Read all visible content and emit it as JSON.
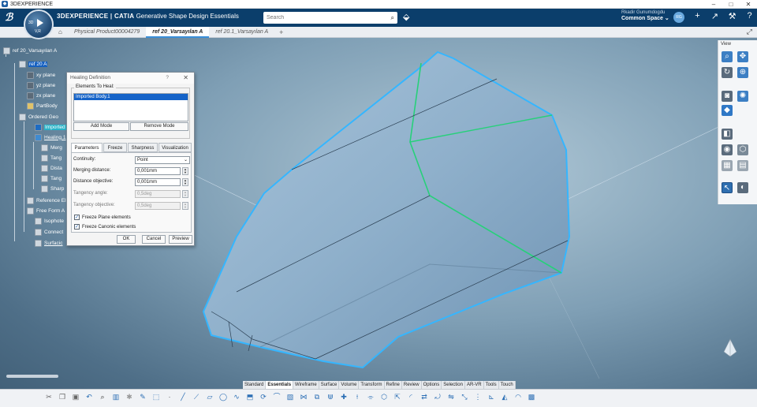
{
  "window": {
    "title": "3DEXPERIENCE",
    "controls": [
      "–",
      "□",
      "✕"
    ]
  },
  "topbar": {
    "brand_bold": "3DEXPERIENCE | CATIA",
    "brand_app": "Generative Shape Design Essentials",
    "compass_top": "3D",
    "compass_bottom": "V,R",
    "search_placeholder": "Search",
    "user_name": "Rkadir Gunumdogdu",
    "space": "Common Space ⌄",
    "avatar": "RG",
    "icons": [
      "+",
      "↗",
      "⚒",
      "?"
    ]
  },
  "tabs": {
    "items": [
      {
        "label": "Physical Product00004279",
        "active": false
      },
      {
        "label": "ref 20_Varsayılan A",
        "active": true
      },
      {
        "label": "ref 20.1_Varsayılan A",
        "active": false
      }
    ],
    "new_tab": "+"
  },
  "tree": {
    "nodes": [
      {
        "label": "ref 20_Varsayılan A",
        "style": "normal"
      },
      {
        "label": "ref 20 A",
        "style": "hl"
      },
      {
        "label": "xy plane",
        "style": "normal"
      },
      {
        "label": "yz plane",
        "style": "normal"
      },
      {
        "label": "zx plane",
        "style": "normal"
      },
      {
        "label": "PartBody",
        "style": "normal"
      },
      {
        "label": "Ordered Geo",
        "style": "normal"
      },
      {
        "label": "Imported",
        "style": "cyan"
      },
      {
        "label": "Healing.1",
        "style": "ul"
      },
      {
        "label": "Merg",
        "style": "normal"
      },
      {
        "label": "Tang",
        "style": "normal"
      },
      {
        "label": "Dista",
        "style": "normal"
      },
      {
        "label": "Tang",
        "style": "normal"
      },
      {
        "label": "Sharp",
        "style": "normal"
      },
      {
        "label": "Reference El",
        "style": "normal"
      },
      {
        "label": "Free Form A",
        "style": "normal"
      },
      {
        "label": "Isophote",
        "style": "normal"
      },
      {
        "label": "Connect",
        "style": "normal"
      },
      {
        "label": "Surfacic",
        "style": "ul"
      }
    ]
  },
  "dialog": {
    "title": "Healing Definition",
    "help": "?",
    "close": "✕",
    "group_label": "Elements To Heal:",
    "elements": [
      "Imported Body.1"
    ],
    "add_mode": "Add Mode",
    "remove_mode": "Remove Mode",
    "tabs": [
      "Parameters",
      "Freeze",
      "Sharpness",
      "Visualization"
    ],
    "active_tab": "Parameters",
    "params": {
      "continuity_label": "Continuity:",
      "continuity_value": "Point",
      "merging_label": "Merging distance:",
      "merging_value": "0,001mm",
      "distobj_label": "Distance objective:",
      "distobj_value": "0,001mm",
      "tangangle_label": "Tangency angle:",
      "tangangle_value": "0,5deg",
      "tangobj_label": "Tangency objective:",
      "tangobj_value": "0,5deg"
    },
    "checks": [
      {
        "label": "Freeze Plane elements",
        "checked": true
      },
      {
        "label": "Freeze Canonic elements",
        "checked": true
      }
    ],
    "ok": "OK",
    "cancel": "Cancel",
    "preview": "Preview"
  },
  "right_panel": {
    "header": "View"
  },
  "bottom_tabs": {
    "items": [
      "Standard",
      "Essentials",
      "Wireframe",
      "Surface",
      "Volume",
      "Transform",
      "Refine",
      "Review",
      "Options",
      "Selection",
      "AR-VR",
      "Tools",
      "Touch"
    ],
    "active": "Essentials"
  },
  "colors": {
    "accent": "#3a8fd9",
    "topbar": "#0b3e6b",
    "highlight_green": "#27d07a",
    "highlight_blue": "#2fb4ff"
  }
}
